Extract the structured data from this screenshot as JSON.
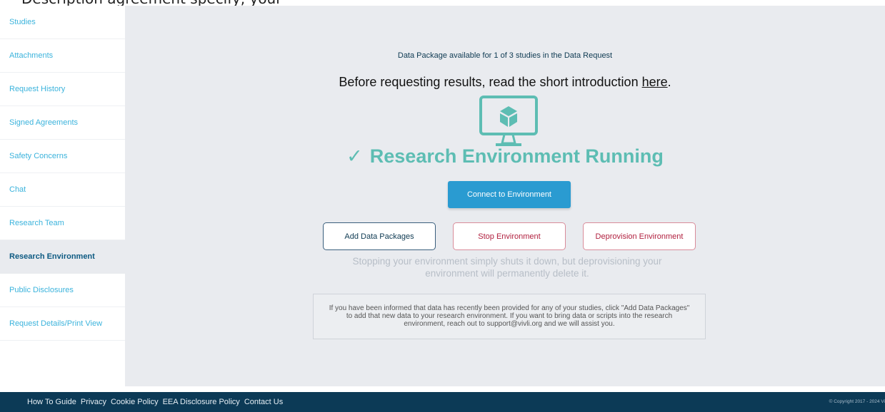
{
  "top_cut_text": "Description agreement specify, your",
  "sidebar": {
    "items": [
      {
        "label": "Studies"
      },
      {
        "label": "Attachments"
      },
      {
        "label": "Request History"
      },
      {
        "label": "Signed Agreements"
      },
      {
        "label": "Safety Concerns"
      },
      {
        "label": "Chat"
      },
      {
        "label": "Research Team"
      },
      {
        "label": "Research Environment"
      },
      {
        "label": "Public Disclosures"
      },
      {
        "label": "Request Details/Print View"
      }
    ],
    "active": "Research Environment"
  },
  "main": {
    "package_status": "Data Package available for 1 of 3 studies in the Data Request",
    "intro_prefix": "Before requesting results, read the short introduction ",
    "intro_link": "here",
    "intro_suffix": ".",
    "monitor_icon": "monitor-cube-icon",
    "status_check": "✓",
    "status_text": "Research Environment Running",
    "connect_button": "Connect to Environment",
    "add_button": "Add Data Packages",
    "stop_button": "Stop Environment",
    "deprovision_button": "Deprovision Environment",
    "note": "Stopping your environment simply shuts it down, but deprovisioning your environment will permanently delete it.",
    "info": "If you have been informed that data has recently been provided for any of your studies, click \"Add Data Packages\" to add that new data to your research environment. If you want to bring data or scripts into the research environment, reach out to support@vivli.org and we will assist you."
  },
  "footer": {
    "links": [
      "How To Guide",
      "Privacy",
      "Cookie Policy",
      "EEA Disclosure Policy",
      "Contact Us"
    ],
    "copyright": "© Copyright 2017 - 2024 Vi"
  },
  "colors": {
    "accent": "#2a9bd1",
    "teal": "#5dbdb3",
    "danger": "#b1203f",
    "footer": "#0c3a56"
  }
}
